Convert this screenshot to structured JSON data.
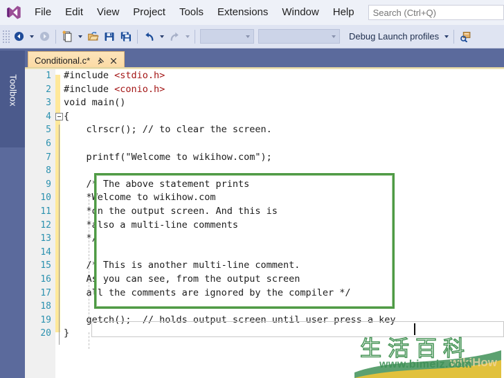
{
  "app": {
    "logo_icon": "visual-studio-logo",
    "search": {
      "placeholder": "Search (Ctrl+Q)",
      "value": ""
    }
  },
  "menubar": {
    "items": [
      {
        "label": "File"
      },
      {
        "label": "Edit"
      },
      {
        "label": "View"
      },
      {
        "label": "Project"
      },
      {
        "label": "Tools"
      },
      {
        "label": "Extensions"
      },
      {
        "label": "Window"
      },
      {
        "label": "Help"
      }
    ]
  },
  "toolbar": {
    "nav_back_icon": "arrow-back-icon",
    "nav_forward_icon": "arrow-forward-icon",
    "new_item_icon": "new-file-icon",
    "open_icon": "open-folder-icon",
    "save_icon": "save-icon",
    "save_all_icon": "save-all-icon",
    "undo_icon": "undo-arrow-icon",
    "redo_icon": "redo-arrow-icon",
    "combo_left_value": "",
    "combo_right_value": "",
    "debug_profiles_label": "Debug Launch profiles",
    "attach_icon": "attach-to-process-icon"
  },
  "sidebar": {
    "toolbox_label": "Toolbox"
  },
  "tabs": {
    "active": {
      "title": "Conditional.c*",
      "pin_icon": "pin-icon",
      "close_icon": "close-icon"
    }
  },
  "editor": {
    "language": "c",
    "accent_changebar_color": "#ffe89a",
    "linenumber_color": "#2b91af",
    "highlight_border_color": "#4f9a45",
    "preprocessor_string_color": "#a31515",
    "caret_after_text": "key",
    "lines": [
      {
        "n": 1,
        "text": "#include <stdio.h>"
      },
      {
        "n": 2,
        "text": "#include <conio.h>"
      },
      {
        "n": 3,
        "text": "void main()"
      },
      {
        "n": 4,
        "text": "{"
      },
      {
        "n": 5,
        "text": "    clrscr(); // to clear the screen."
      },
      {
        "n": 6,
        "text": ""
      },
      {
        "n": 7,
        "text": "    printf(\"Welcome to wikihow.com\");"
      },
      {
        "n": 8,
        "text": ""
      },
      {
        "n": 9,
        "text": "    /* The above statement prints"
      },
      {
        "n": 10,
        "text": "    *Welcome to wikihow.com"
      },
      {
        "n": 11,
        "text": "    *on the output screen. And this is"
      },
      {
        "n": 12,
        "text": "    *also a multi-line comments"
      },
      {
        "n": 13,
        "text": "    */"
      },
      {
        "n": 14,
        "text": ""
      },
      {
        "n": 15,
        "text": "    /* This is another multi-line comment."
      },
      {
        "n": 16,
        "text": "    As you can see, from the output screen"
      },
      {
        "n": 17,
        "text": "    all the comments are ignored by the compiler */"
      },
      {
        "n": 18,
        "text": ""
      },
      {
        "n": 19,
        "text": "    getch();  // holds output screen until user press a key"
      },
      {
        "n": 20,
        "text": "}"
      }
    ]
  },
  "watermark": {
    "cjk_text": "生活百科",
    "url_text": "www.bimeiz.com",
    "faded_text": "wikiHow"
  }
}
